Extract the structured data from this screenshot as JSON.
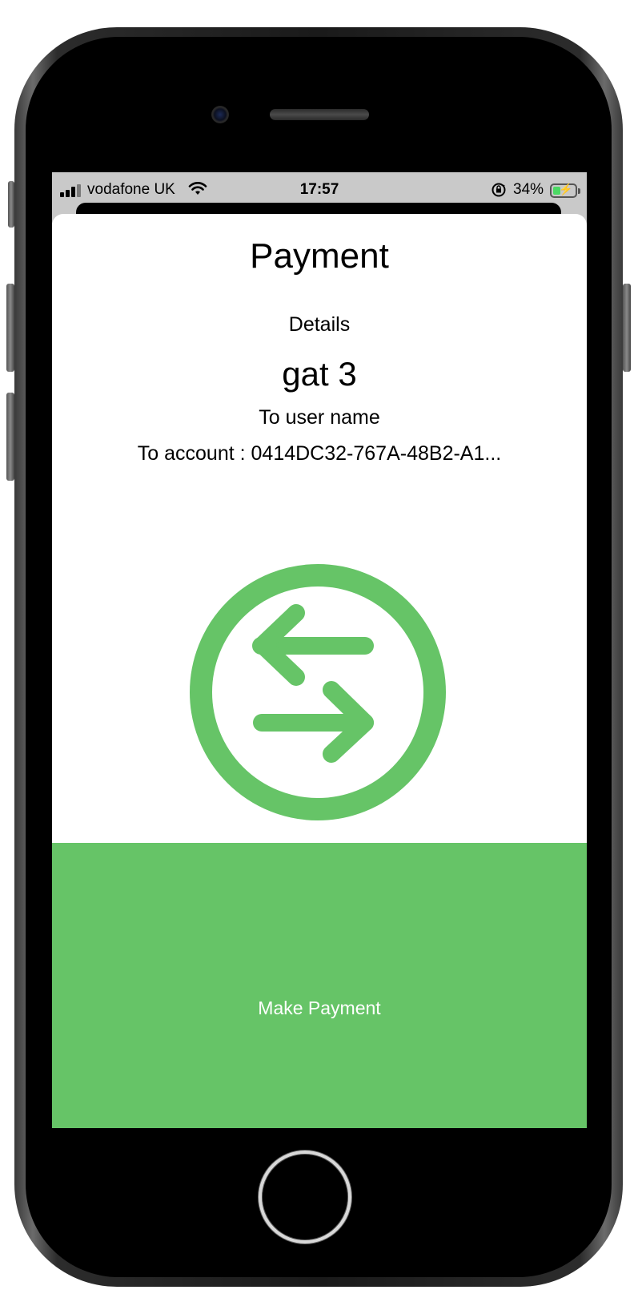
{
  "status_bar": {
    "carrier": "vodafone UK",
    "time": "17:57",
    "battery_percent": "34%",
    "battery_level": 0.34,
    "icons": [
      "signal-icon",
      "wifi-icon",
      "rotation-lock-icon",
      "battery-charging-icon"
    ]
  },
  "payment": {
    "title": "Payment",
    "details_label": "Details",
    "recipient_name": "gat 3",
    "to_user_label": "To user name",
    "to_account": "To account : 0414DC32-767A-48B2-A1..."
  },
  "transfer_icon": {
    "name": "transfer-arrows-icon",
    "color": "#66c467"
  },
  "actions": {
    "make_payment_label": "Make Payment",
    "button_color": "#66c467"
  }
}
